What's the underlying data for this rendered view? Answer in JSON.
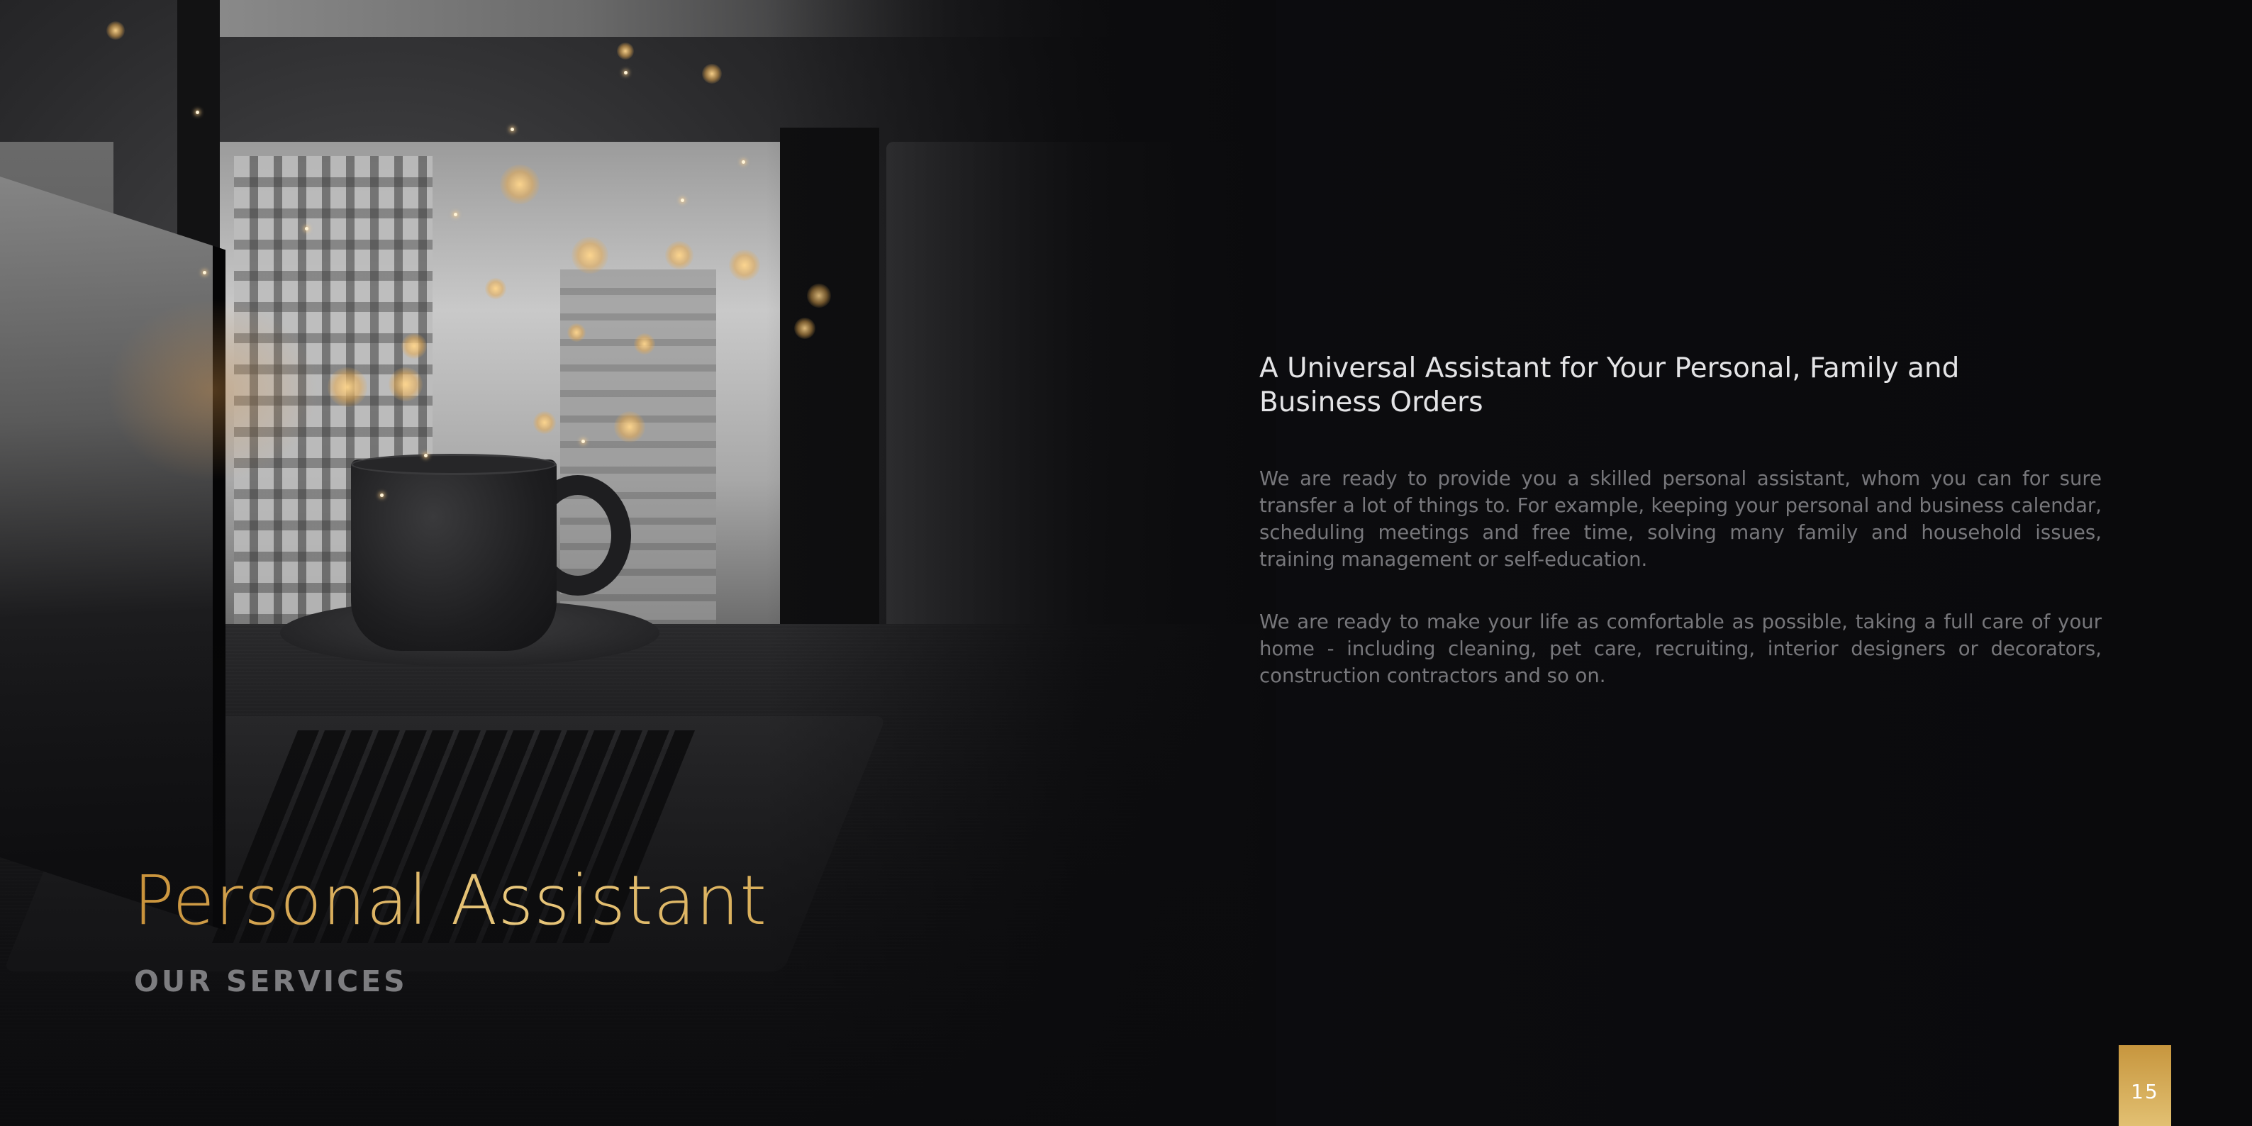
{
  "page": {
    "title": "Personal Assistant",
    "section_label": "OUR SERVICES",
    "page_number": "15"
  },
  "content": {
    "heading": "A Universal Assistant for Your Personal, Family and Business Orders",
    "paragraph_1": "We are ready to provide you a skilled personal assistant, whom you can for sure transfer a lot of things to. For example, keeping your personal and business calendar, scheduling meetings and free time, solving many family and household issues, training management or self-education.",
    "paragraph_2": "We are ready to make your life as comfortable as possible, taking a full care of your home - including cleaning, pet care, recruiting, interior designers or decorators, construction contractors and so on."
  },
  "colors": {
    "background": "#0b0b0d",
    "accent_gold": "#d6a84c",
    "heading_text": "#e4e4e6",
    "body_text": "#77777b",
    "section_label": "#7d7d80"
  },
  "image": {
    "subject": "laptop-and-coffee-cup-by-window-photo"
  }
}
